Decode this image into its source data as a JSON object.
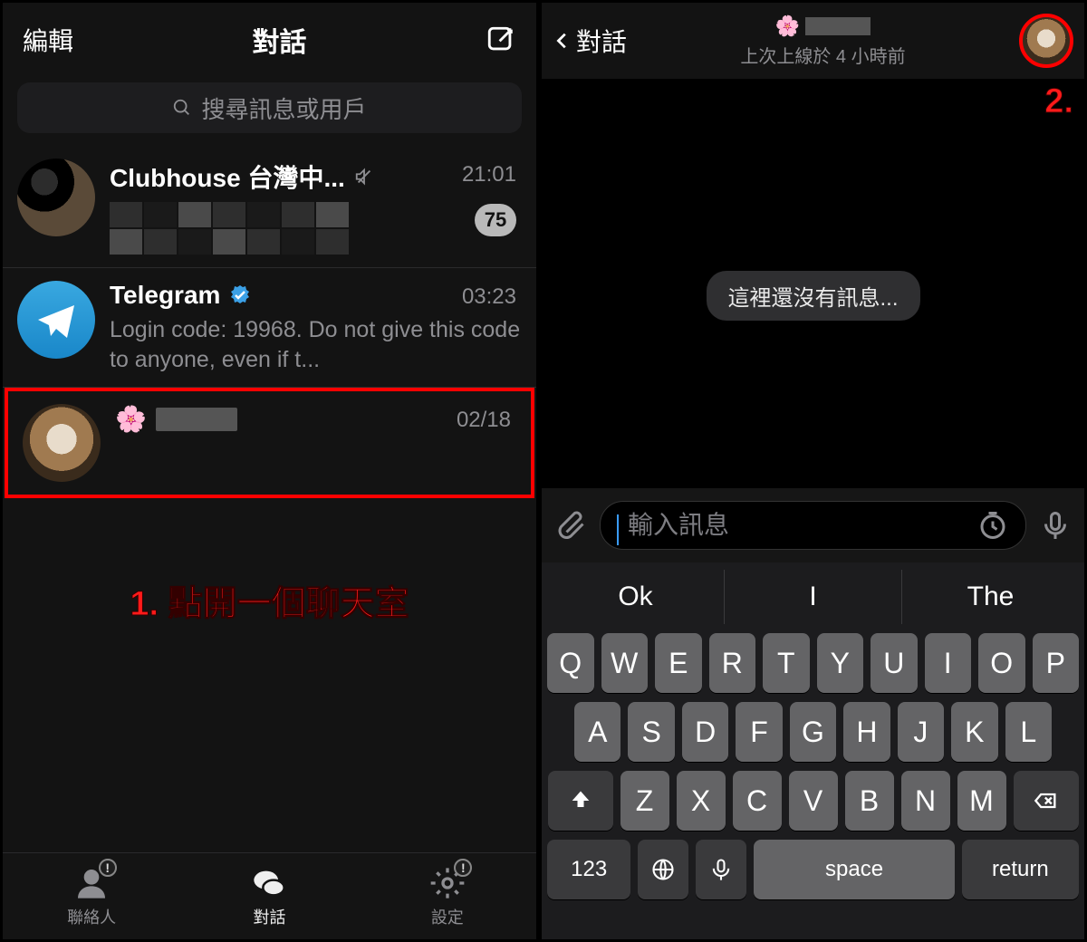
{
  "left": {
    "edit": "編輯",
    "title": "對話",
    "search_placeholder": "搜尋訊息或用戶",
    "chats": [
      {
        "name": "Clubhouse 台灣中...",
        "muted": true,
        "time": "21:01",
        "unread": "75",
        "preview_hidden": true
      },
      {
        "name": "Telegram",
        "verified": true,
        "time": "03:23",
        "preview": "Login code: 19968. Do not give this code to anyone, even if t..."
      },
      {
        "name_emoji": "🌸",
        "name_hidden": true,
        "time": "02/18",
        "highlighted": true
      }
    ],
    "annotation": "1. 點開一個聊天室",
    "tabs": [
      {
        "label": "聯絡人",
        "icon": "contacts-icon",
        "badge": "!"
      },
      {
        "label": "對話",
        "icon": "chats-icon",
        "active": true
      },
      {
        "label": "設定",
        "icon": "settings-icon",
        "badge": "!"
      }
    ]
  },
  "right": {
    "back": "對話",
    "contact_emoji": "🌸",
    "status": "上次上線於 4 小時前",
    "annotation": "2.",
    "empty_text": "這裡還沒有訊息...",
    "input_placeholder": "輸入訊息",
    "suggestions": [
      "Ok",
      "I",
      "The"
    ],
    "keyboard": {
      "row1": [
        "Q",
        "W",
        "E",
        "R",
        "T",
        "Y",
        "U",
        "I",
        "O",
        "P"
      ],
      "row2": [
        "A",
        "S",
        "D",
        "F",
        "G",
        "H",
        "J",
        "K",
        "L"
      ],
      "row3": [
        "Z",
        "X",
        "C",
        "V",
        "B",
        "N",
        "M"
      ],
      "num": "123",
      "space": "space",
      "return": "return"
    }
  }
}
